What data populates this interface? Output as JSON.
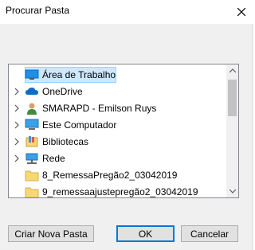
{
  "dialog": {
    "title": "Procurar Pasta"
  },
  "tree": {
    "items": [
      {
        "label": "Área de Trabalho",
        "icon": "desktop-icon",
        "expandable": false,
        "selected": true
      },
      {
        "label": "OneDrive",
        "icon": "cloud-icon",
        "expandable": true
      },
      {
        "label": "SMARAPD - Emilson Ruys",
        "icon": "user-icon",
        "expandable": true
      },
      {
        "label": "Este Computador",
        "icon": "computer-icon",
        "expandable": true
      },
      {
        "label": "Bibliotecas",
        "icon": "library-icon",
        "expandable": true
      },
      {
        "label": "Rede",
        "icon": "network-icon",
        "expandable": true
      },
      {
        "label": "8_RemessaPregão2_03042019",
        "icon": "folder-icon",
        "expandable": false
      },
      {
        "label": "9_remessaajustepregão2_03042019",
        "icon": "folder-icon",
        "expandable": false
      }
    ]
  },
  "buttons": {
    "new_folder": "Criar Nova Pasta",
    "ok": "OK",
    "cancel": "Cancelar"
  },
  "colors": {
    "selection_bg": "#cce8ff",
    "primary_border": "#0078d7",
    "folder": "#f8d775"
  }
}
